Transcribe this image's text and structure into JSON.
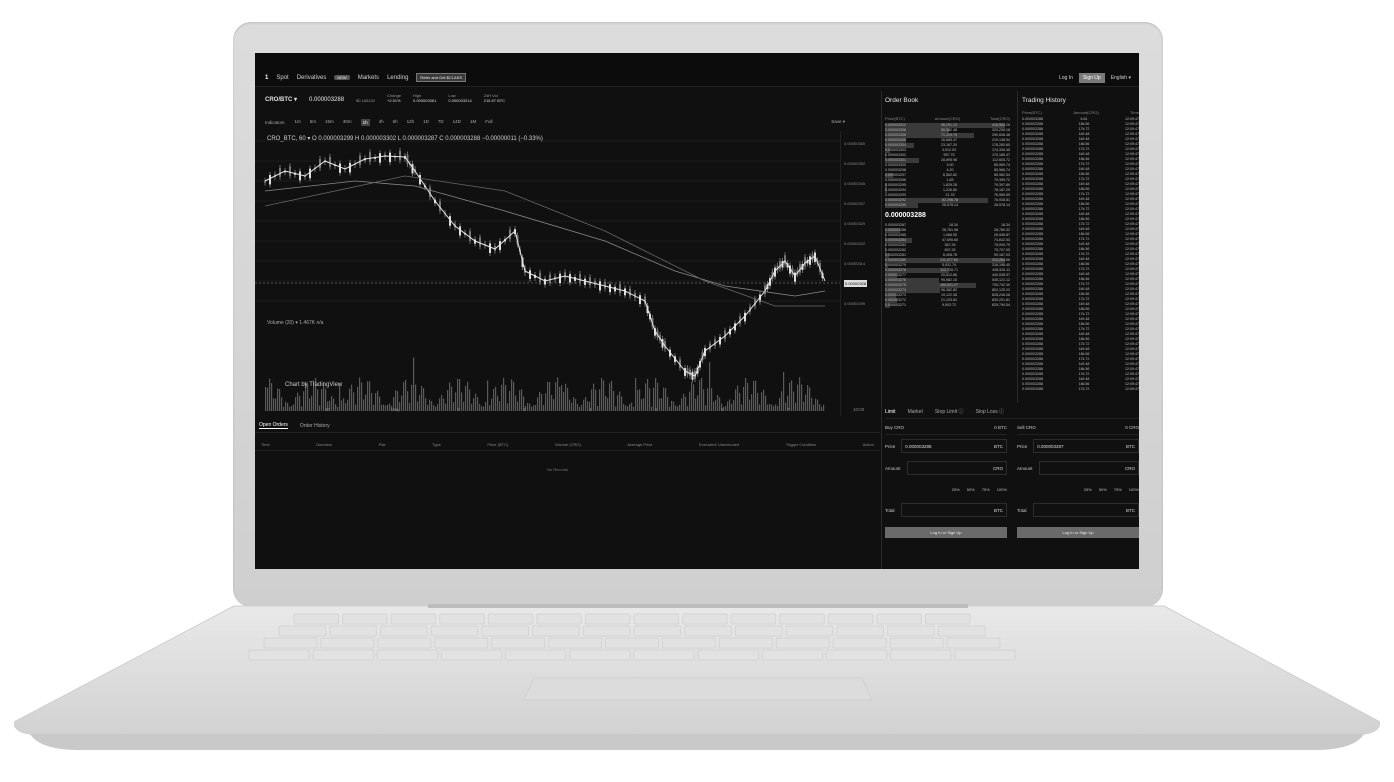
{
  "nav": {
    "logo": "1",
    "items": [
      "Spot",
      "Derivatives",
      "Markets",
      "Lending"
    ],
    "derivatives_badge": "NEW",
    "promo": "Refer and Get $CLASS",
    "login": "Log In",
    "signup": "Sign Up",
    "language": "English ▾"
  },
  "ticker": {
    "pair": "CRO/BTC ▾",
    "price": "0.000003288",
    "price_usd": "$0.165132",
    "change_label": "Change",
    "change": "+2.51%",
    "high_label": "High",
    "high": "0.000003361",
    "low_label": "Low",
    "low": "0.000003214",
    "vol_label": "24H Vol",
    "vol": "215.87 BTC"
  },
  "toolbar": {
    "indicators": "Indicators",
    "intervals": [
      "1m",
      "5m",
      "15m",
      "30m",
      "1h",
      "4h",
      "6h",
      "12h",
      "1D",
      "7D",
      "14D",
      "1M",
      "Full"
    ],
    "active_interval": "1h",
    "save": "Save ▾"
  },
  "chart": {
    "legend": "CRO_BTC, 60 ▾   O 0.000003299  H 0.000003302  L 0.000003287  C 0.000003288  −0.00000011 (−0.33%)",
    "volume_label": "Volume (20) ▾   1.467K  n/a",
    "tradingview": "Chart by TradingView",
    "x_ticks": [
      "30",
      "May",
      "2",
      "3",
      "4",
      "5",
      "6",
      "7",
      "10:00"
    ],
    "price_ticks": [
      "0.00000360",
      "0.00000352",
      "0.00000345",
      "0.00000337",
      "0.00000329",
      "0.00000322",
      "0.00000314",
      "0.00000307",
      "0.00000299"
    ],
    "current_price": "0.00000328"
  },
  "orders": {
    "tabs": [
      "Open Orders",
      "Order History"
    ],
    "columns": [
      "Time",
      "Direction",
      "Pair",
      "Type",
      "Price (BTC)",
      "Volume (CRO)",
      "Average Price",
      "Executed/ Unexecuted",
      "Trigger Condition",
      "Action"
    ],
    "empty": "No Records"
  },
  "orderbook": {
    "title": "Order Book",
    "columns": [
      "Price(BTC)",
      "Amount(CRO)",
      "Total(CRO)"
    ],
    "asks": [
      [
        "0.000003312",
        "96,291.13",
        "416,563.26"
      ],
      [
        "0.000003308",
        "50,982.48",
        "320,295.18"
      ],
      [
        "0.000003306",
        "71,419.75",
        "290,608.48"
      ],
      [
        "0.000003305",
        "16,665.47",
        "219,138.94"
      ],
      [
        "0.000003304",
        "23,167.20",
        "178,260.65"
      ],
      [
        "0.000003303",
        "3,912.03",
        "174,339.45"
      ],
      [
        "0.000003302",
        "957.75",
        "170,185.47"
      ],
      [
        "0.000003301",
        "26,895.98",
        "112,605.72"
      ],
      [
        "0.000003300",
        "3.00",
        "85,969.74"
      ],
      [
        "0.000003298",
        "4.20",
        "85,966.74"
      ],
      [
        "0.000003297",
        "6,562.82",
        "85,962.54"
      ],
      [
        "0.000003296",
        "1.83",
        "79,399.72"
      ],
      [
        "0.000003295",
        "1,829.28",
        "79,397.89"
      ],
      [
        "0.000003294",
        "1,226.80",
        "78,187.29"
      ],
      [
        "0.000003293",
        "21.78",
        "76,960.59"
      ],
      [
        "0.000003292",
        "82,296.78",
        "76,938.81"
      ],
      [
        "0.000003290",
        "26,578.14",
        "26,578.14"
      ]
    ],
    "last": "0.000003288",
    "bids": [
      [
        "0.000003287",
        "18.34",
        "18.34"
      ],
      [
        "0.000003286",
        "26,761.98",
        "26,780.32"
      ],
      [
        "0.000003285",
        "1,066.55",
        "26,946.87"
      ],
      [
        "0.000003284",
        "47,695.66",
        "74,642.53"
      ],
      [
        "0.000003283",
        "367.26",
        "75,009.79"
      ],
      [
        "0.000003282",
        "697.26",
        "75,707.05"
      ],
      [
        "0.000003281",
        "6,408.78",
        "99,187.03"
      ],
      [
        "0.000003280",
        "211,077.63",
        "310,264.66"
      ],
      [
        "0.000003279",
        "5,931.74",
        "316,196.40"
      ],
      [
        "0.000003278",
        "112,728.71",
        "428,925.11"
      ],
      [
        "0.000003277",
        "20,612.86",
        "449,538.97"
      ],
      [
        "0.000003276",
        "95,582.15",
        "545,121.12"
      ],
      [
        "0.000003275",
        "160,621.27",
        "705,742.39"
      ],
      [
        "0.000003274",
        "96,382.83",
        "802,125.22"
      ],
      [
        "0.000003273",
        "19,122.38",
        "828,246.06"
      ],
      [
        "0.000003272",
        "21,103.82",
        "830,201.81"
      ],
      [
        "0.000003271",
        "9,503.72",
        "829,794.54"
      ]
    ]
  },
  "history": {
    "title": "Trading History",
    "columns": [
      "Price(BTC)",
      "Amount(CRO)",
      "Time"
    ],
    "rows": [
      [
        "0.000003288",
        "6.81",
        "12:09:47"
      ],
      [
        "0.000003288",
        "18k.56",
        "12:09:47"
      ],
      [
        "0.000003288",
        "17k.72",
        "12:09:47"
      ],
      [
        "0.000003288",
        "1k9.48",
        "12:09:47"
      ],
      [
        "0.000003288",
        "1k9.48",
        "12:09:47"
      ],
      [
        "0.000003288",
        "18k.56",
        "12:09:47"
      ],
      [
        "0.000003288",
        "17k.72",
        "12:09:47"
      ],
      [
        "0.000003288",
        "1k9.48",
        "12:09:47"
      ],
      [
        "0.000003288",
        "18k.56",
        "12:09:47"
      ],
      [
        "0.000003288",
        "17k.72",
        "12:09:47"
      ],
      [
        "0.000003288",
        "1k9.48",
        "12:09:47"
      ],
      [
        "0.000003288",
        "18k.56",
        "12:09:47"
      ],
      [
        "0.000003288",
        "17k.72",
        "12:09:47"
      ],
      [
        "0.000003288",
        "1k9.48",
        "12:09:47"
      ],
      [
        "0.000003288",
        "18k.56",
        "12:09:47"
      ],
      [
        "0.000003288",
        "17k.72",
        "12:09:47"
      ],
      [
        "0.000003288",
        "1k9.48",
        "12:09:47"
      ],
      [
        "0.000003288",
        "18k.56",
        "12:09:47"
      ],
      [
        "0.000003288",
        "17k.72",
        "12:09:47"
      ],
      [
        "0.000003288",
        "1k9.48",
        "12:09:47"
      ],
      [
        "0.000003288",
        "18k.56",
        "12:09:47"
      ],
      [
        "0.000003288",
        "17k.72",
        "12:09:47"
      ],
      [
        "0.000003288",
        "1k9.48",
        "12:09:47"
      ],
      [
        "0.000003288",
        "18k.56",
        "12:09:47"
      ],
      [
        "0.000003288",
        "17k.72",
        "12:09:47"
      ],
      [
        "0.000003288",
        "1k9.48",
        "12:09:47"
      ],
      [
        "0.000003288",
        "18k.56",
        "12:09:47"
      ],
      [
        "0.000003288",
        "17k.72",
        "12:09:47"
      ],
      [
        "0.000003288",
        "1k9.48",
        "12:09:47"
      ],
      [
        "0.000003288",
        "18k.56",
        "12:09:47"
      ],
      [
        "0.000003288",
        "17k.72",
        "12:09:47"
      ],
      [
        "0.000003288",
        "1k9.48",
        "12:09:47"
      ],
      [
        "0.000003288",
        "18k.56",
        "12:09:47"
      ],
      [
        "0.000003288",
        "17k.72",
        "12:09:47"
      ],
      [
        "0.000003288",
        "1k9.48",
        "12:09:47"
      ],
      [
        "0.000003288",
        "18k.56",
        "12:09:47"
      ],
      [
        "0.000003288",
        "17k.72",
        "12:09:47"
      ],
      [
        "0.000003288",
        "1k9.48",
        "12:09:47"
      ],
      [
        "0.000003288",
        "18k.56",
        "12:09:47"
      ],
      [
        "0.000003288",
        "17k.72",
        "12:09:47"
      ],
      [
        "0.000003288",
        "1k9.48",
        "12:09:47"
      ],
      [
        "0.000003288",
        "18k.56",
        "12:09:47"
      ],
      [
        "0.000003288",
        "17k.72",
        "12:09:47"
      ],
      [
        "0.000003288",
        "1k9.48",
        "12:09:47"
      ],
      [
        "0.000003288",
        "18k.56",
        "12:09:47"
      ],
      [
        "0.000003288",
        "17k.72",
        "12:09:47"
      ],
      [
        "0.000003288",
        "1k9.48",
        "12:09:47"
      ],
      [
        "0.000003288",
        "18k.56",
        "12:09:47"
      ],
      [
        "0.000003288",
        "17k.72",
        "12:09:47"
      ],
      [
        "0.000003288",
        "1k9.48",
        "12:09:47"
      ],
      [
        "0.000003288",
        "18k.56",
        "12:09:47"
      ],
      [
        "0.000003288",
        "17k.72",
        "12:09:47"
      ],
      [
        "0.000003288",
        "1k9.48",
        "12:09:47"
      ],
      [
        "0.000003288",
        "18k.56",
        "12:09:47"
      ],
      [
        "0.000003288",
        "17k.72",
        "12:09:47"
      ]
    ]
  },
  "trade": {
    "tabs": [
      "Limit",
      "Market",
      "Stop Limit ⓘ",
      "Stop Loss ⓘ"
    ],
    "buy": {
      "title": "Buy CRO",
      "balance": "0 BTC",
      "price_label": "Price",
      "price": "0.000003288",
      "price_unit": "BTC",
      "amount_label": "Amount",
      "amount_unit": "CRO",
      "total_label": "Total",
      "total_unit": "BTC",
      "button": "Log In or Sign Up"
    },
    "sell": {
      "title": "Sell CRO",
      "balance": "0 CRO",
      "price_label": "Price",
      "price": "0.000003287",
      "price_unit": "BTC",
      "amount_label": "Amount",
      "amount_unit": "CRO",
      "total_label": "Total",
      "total_unit": "BTC",
      "button": "Log In or Sign Up"
    },
    "percents": [
      "25%",
      "50%",
      "75%",
      "100%"
    ]
  }
}
